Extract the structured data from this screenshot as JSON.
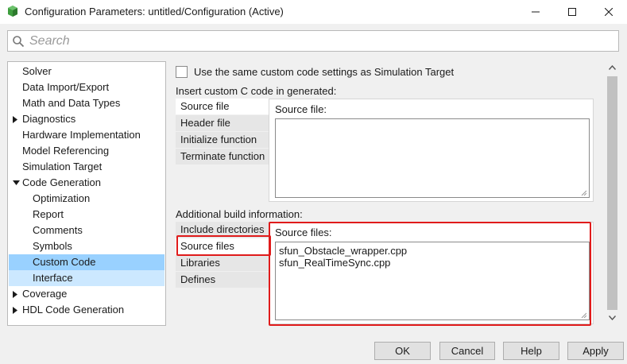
{
  "window": {
    "title": "Configuration Parameters: untitled/Configuration (Active)",
    "app_icon": "simulink-icon",
    "controls": [
      "minimize-icon",
      "maximize-icon",
      "close-icon"
    ]
  },
  "search": {
    "placeholder": "Search",
    "value": ""
  },
  "tree": {
    "items": [
      {
        "label": "Solver",
        "level": 0,
        "expandable": false,
        "state": "normal"
      },
      {
        "label": "Data Import/Export",
        "level": 0,
        "expandable": false,
        "state": "normal"
      },
      {
        "label": "Math and Data Types",
        "level": 0,
        "expandable": false,
        "state": "normal"
      },
      {
        "label": "Diagnostics",
        "level": 0,
        "expandable": true,
        "expanded": false,
        "state": "normal"
      },
      {
        "label": "Hardware Implementation",
        "level": 0,
        "expandable": false,
        "state": "normal"
      },
      {
        "label": "Model Referencing",
        "level": 0,
        "expandable": false,
        "state": "normal"
      },
      {
        "label": "Simulation Target",
        "level": 0,
        "expandable": false,
        "state": "normal"
      },
      {
        "label": "Code Generation",
        "level": 0,
        "expandable": true,
        "expanded": true,
        "state": "normal"
      },
      {
        "label": "Optimization",
        "level": 1,
        "expandable": false,
        "state": "normal"
      },
      {
        "label": "Report",
        "level": 1,
        "expandable": false,
        "state": "normal"
      },
      {
        "label": "Comments",
        "level": 1,
        "expandable": false,
        "state": "normal"
      },
      {
        "label": "Symbols",
        "level": 1,
        "expandable": false,
        "state": "normal"
      },
      {
        "label": "Custom Code",
        "level": 1,
        "expandable": false,
        "state": "selected"
      },
      {
        "label": "Interface",
        "level": 1,
        "expandable": false,
        "state": "hover"
      },
      {
        "label": "Coverage",
        "level": 0,
        "expandable": true,
        "expanded": false,
        "state": "normal"
      },
      {
        "label": "HDL Code Generation",
        "level": 0,
        "expandable": true,
        "expanded": false,
        "state": "normal"
      }
    ]
  },
  "panel": {
    "same_settings_label": "Use the same custom code settings as Simulation Target",
    "same_settings_checked": false,
    "insert_section": {
      "label": "Insert custom C code in generated:",
      "tabs": [
        "Source file",
        "Header file",
        "Initialize function",
        "Terminate function"
      ],
      "active_tab": 0,
      "content_label": "Source file:",
      "content_value": ""
    },
    "build_section": {
      "label": "Additional build information:",
      "tabs": [
        "Include directories",
        "Source files",
        "Libraries",
        "Defines"
      ],
      "active_tab": 1,
      "content_label": "Source files:",
      "content_value": "sfun_Obstacle_wrapper.cpp\nsfun_RealTimeSync.cpp"
    },
    "highlight_color": "#e01b1b"
  },
  "buttons": {
    "ok": "OK",
    "cancel": "Cancel",
    "help": "Help",
    "apply": "Apply"
  },
  "colors": {
    "selected_bg": "#99d1ff",
    "hover_bg": "#cce8ff",
    "window_bg": "#f0f0f0"
  }
}
